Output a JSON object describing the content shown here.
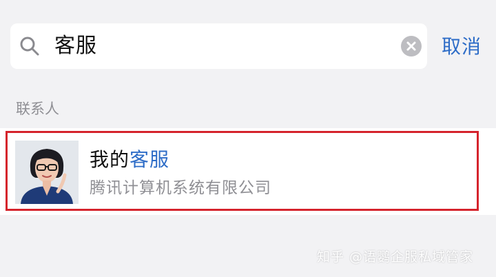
{
  "search": {
    "query": "客服",
    "cancel_label": "取消"
  },
  "results": {
    "section_label": "联系人",
    "contacts": [
      {
        "name_prefix": "我的",
        "name_highlight": "客服",
        "company": "腾讯计算机系统有限公司"
      }
    ]
  },
  "watermark": "知乎 @语鹦企服私域管家",
  "colors": {
    "accent": "#2d6cc7",
    "highlight_border": "#d5232c",
    "background": "#f2f2f4"
  },
  "icons": {
    "search": "search-icon",
    "clear": "clear-icon"
  }
}
